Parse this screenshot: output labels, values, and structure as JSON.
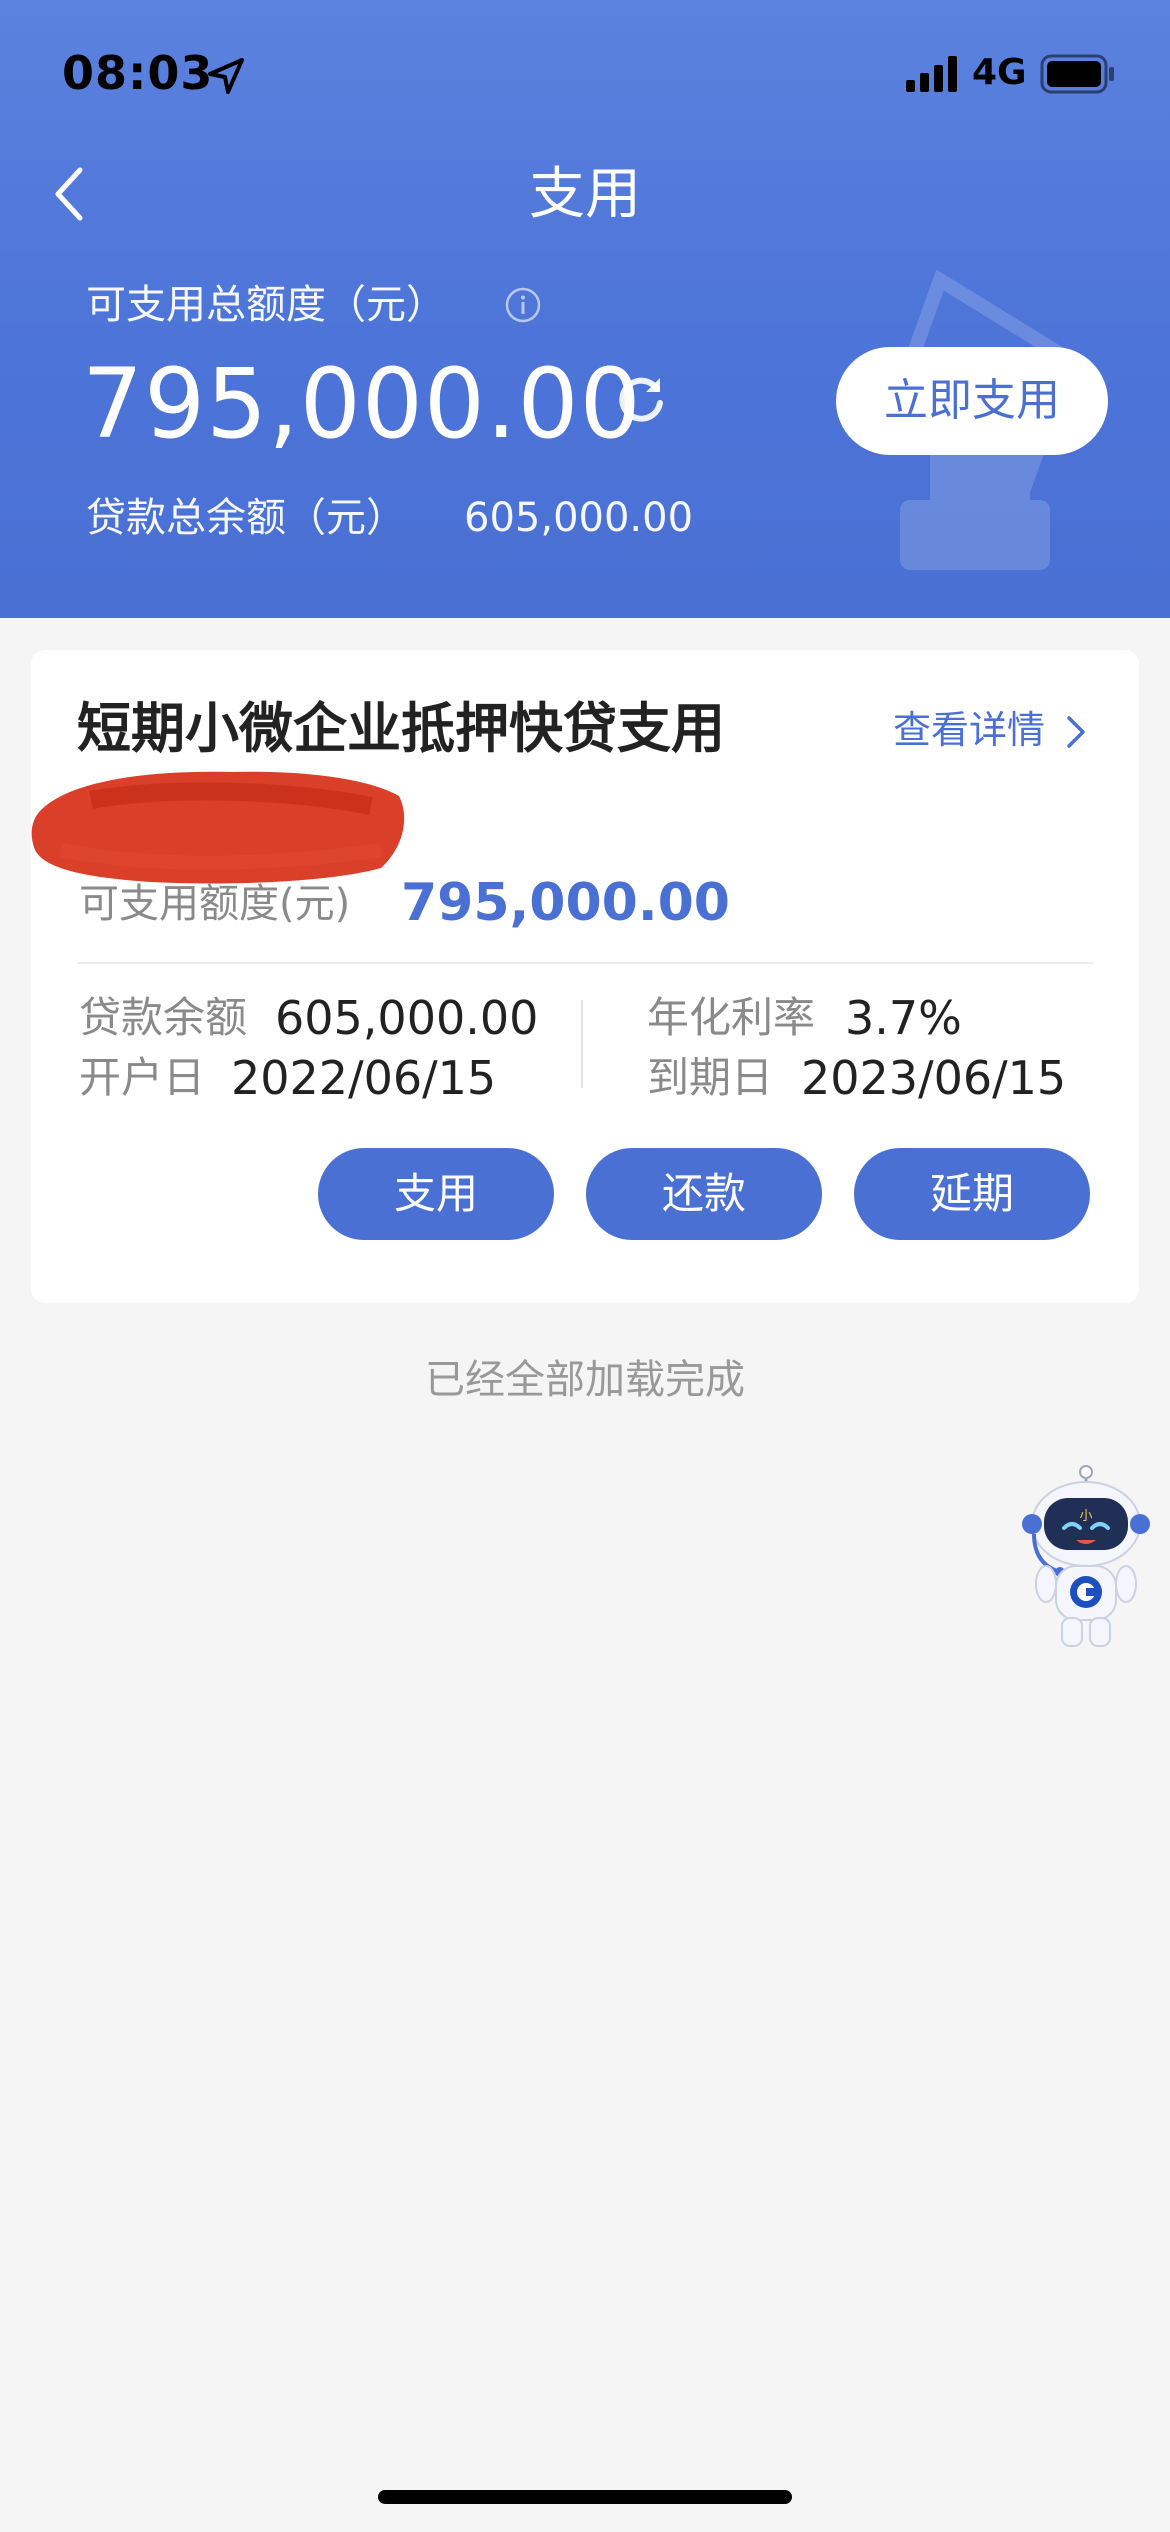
{
  "status": {
    "time": "08:03",
    "network": "4G"
  },
  "header": {
    "title": "支用",
    "total_label": "可支用总额度（元）",
    "total_amount": "795,000.00",
    "use_now_label": "立即支用",
    "balance_label": "贷款总余额（元）",
    "balance_value": "605,000.00"
  },
  "card": {
    "product_name": "短期小微企业抵押快贷支用",
    "view_details": "查看详情",
    "available_label": "可支用额度(元)",
    "available_value": "795,000.00",
    "loan_balance_label": "贷款余额",
    "loan_balance_value": "605,000.00",
    "annual_rate_label": "年化利率",
    "annual_rate_value": "3.7%",
    "open_date_label": "开户日",
    "open_date_value": "2022/06/15",
    "due_date_label": "到期日",
    "due_date_value": "2023/06/15",
    "buttons": {
      "use": "支用",
      "repay": "还款",
      "extend": "延期"
    }
  },
  "footer_text": "已经全部加载完成",
  "colors": {
    "accent": "#4a70d4",
    "header_bg": "#5b82de",
    "redaction": "#d8351f"
  },
  "icons": [
    "location-arrow-icon",
    "signal-icon",
    "battery-icon",
    "back-icon",
    "info-icon",
    "refresh-icon",
    "chevron-right-icon",
    "assistant-robot-icon"
  ]
}
